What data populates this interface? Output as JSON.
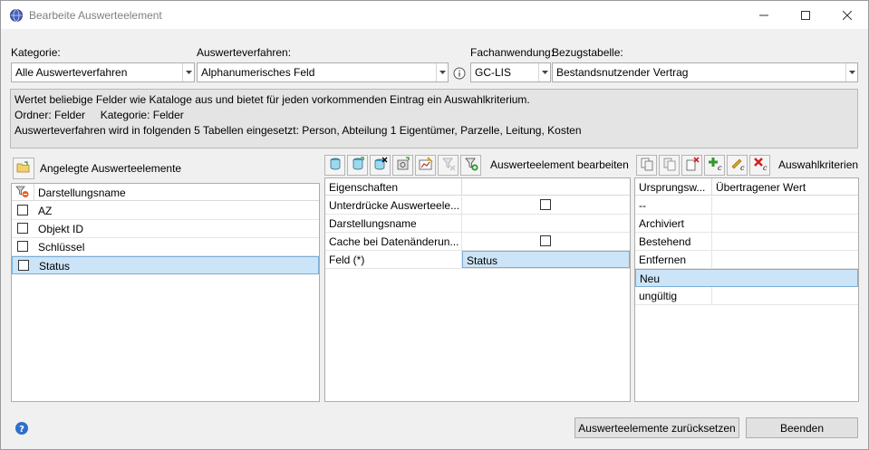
{
  "window": {
    "title": "Bearbeite Auswerteelement",
    "controls": [
      "minimize-icon",
      "maximize-icon",
      "close-icon"
    ]
  },
  "filters": {
    "kategorie_label": "Kategorie:",
    "kategorie_value": "Alle Auswerteverfahren",
    "verfahren_label": "Auswerteverfahren:",
    "verfahren_value": "Alphanumerisches Feld",
    "fachanwendung_label": "Fachanwendung:",
    "fachanwendung_value": "GC-LIS",
    "bezugstabelle_label": "Bezugstabelle:",
    "bezugstabelle_value": "Bestandsnutzender Vertrag"
  },
  "info": {
    "line1": "Wertet beliebige Felder wie Kataloge aus und bietet für jeden vorkommenden Eintrag ein Auswahlkriterium.",
    "line2": "Ordner: Felder     Kategorie: Felder",
    "line3": "Auswerteverfahren wird in folgenden 5 Tabellen eingesetzt: Person, Abteilung 1 Eigentümer, Parzelle, Leitung, Kosten"
  },
  "left_panel": {
    "title": "Angelegte Auswerteelemente",
    "column": "Darstellungsname",
    "rows": [
      "AZ",
      "Objekt ID",
      "Schlüssel",
      "Status"
    ],
    "selected_index": 3
  },
  "middle_panel": {
    "title": "Auswerteelement bearbeiten",
    "toolbar_icons": [
      "add-table-icon",
      "add-linked-icon",
      "delete-table-icon",
      "settings-icon",
      "edit-chart-icon",
      "filter-disabled-icon",
      "filter-add-icon"
    ],
    "column": "Eigenschaften",
    "rows": [
      {
        "name": "Unterdrücke Auswerteele...",
        "value": "",
        "checkbox": true
      },
      {
        "name": "Darstellungsname",
        "value": "",
        "checkbox": false
      },
      {
        "name": "Cache bei Datenänderun...",
        "value": "",
        "checkbox": true
      },
      {
        "name": "Feld (*)",
        "value": "Status",
        "checkbox": false
      }
    ]
  },
  "right_panel": {
    "title": "Auswahlkriterien",
    "toolbar_icons": [
      "copy-icon",
      "paste-icon",
      "delete-icon",
      "add-criterion-icon",
      "edit-criterion-icon",
      "remove-criterion-icon"
    ],
    "columns": [
      "Ursprungsw...",
      "Übertragener Wert"
    ],
    "rows": [
      {
        "origin": "--",
        "value": ""
      },
      {
        "origin": "Archiviert",
        "value": ""
      },
      {
        "origin": "Bestehend",
        "value": ""
      },
      {
        "origin": "Entfernen",
        "value": ""
      },
      {
        "origin": "Neu",
        "value": ""
      },
      {
        "origin": "ungültig",
        "value": ""
      }
    ],
    "selected_index": 4
  },
  "footer": {
    "reset_label": "Auswerteelemente zurücksetzen",
    "close_label": "Beenden",
    "help_icon": "help-icon"
  }
}
